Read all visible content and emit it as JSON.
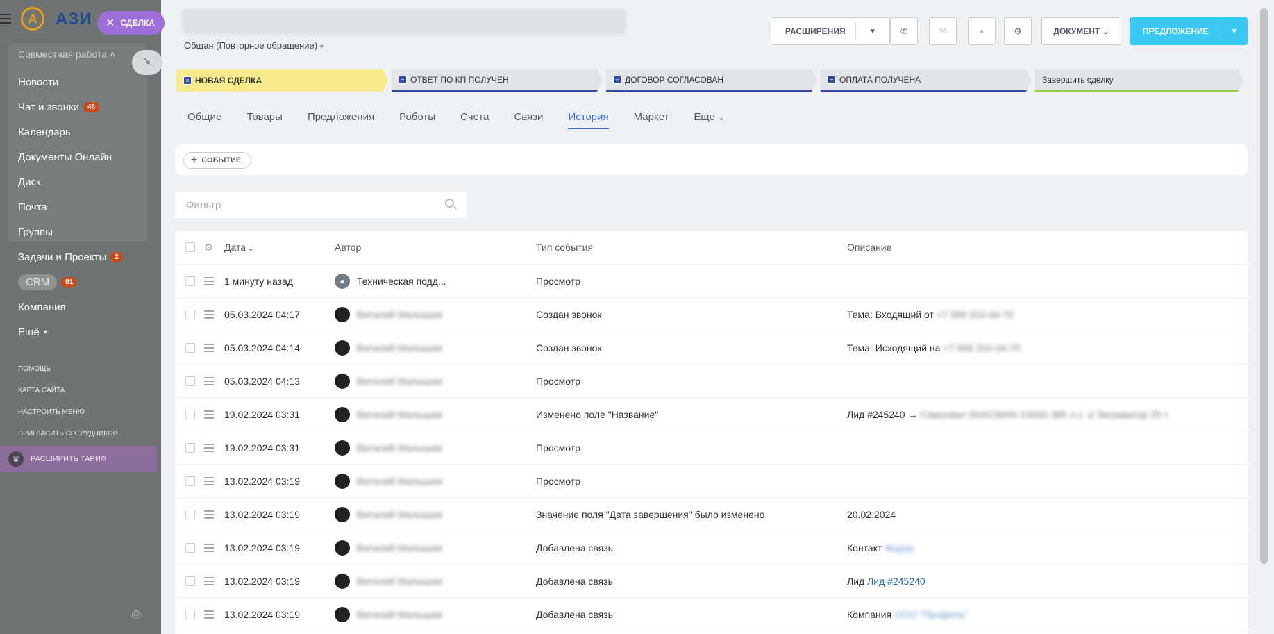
{
  "sidebar": {
    "logo": "A",
    "brand": "АЗИ",
    "deal_chip": "СДЕЛКА",
    "collab_title": "Совместная работа",
    "items": [
      {
        "label": "Новости"
      },
      {
        "label": "Чат и звонки",
        "badge": "46"
      },
      {
        "label": "Календарь"
      },
      {
        "label": "Документы Онлайн"
      },
      {
        "label": "Диск"
      },
      {
        "label": "Почта"
      },
      {
        "label": "Группы"
      },
      {
        "label": "Задачи и Проекты",
        "badge": "2"
      },
      {
        "label": "CRM",
        "badge": "81"
      },
      {
        "label": "Компания"
      },
      {
        "label": "Ещё"
      }
    ],
    "small_links": [
      "ПОМОЩЬ",
      "КАРТА САЙТА",
      "НАСТРОИТЬ МЕНЮ",
      "ПРИГЛАСИТЬ СОТРУДНИКОВ"
    ],
    "upgrade": "РАСШИРИТЬ ТАРИФ"
  },
  "header": {
    "subtitle": "Общая (Повторное обращение)",
    "extensions_label": "РАСШИРЕНИЯ",
    "document_label": "ДОКУМЕНТ",
    "offer_label": "ПРЕДЛОЖЕНИЕ"
  },
  "stages": [
    {
      "label": "НОВАЯ СДЕЛКА"
    },
    {
      "label": "ОТВЕТ ПО КП ПОЛУЧЕН"
    },
    {
      "label": "ДОГОВОР СОГЛАСОВАН"
    },
    {
      "label": "ОПЛАТА ПОЛУЧЕНА"
    },
    {
      "label": "Завершить сделку"
    }
  ],
  "tabs": [
    {
      "label": "Общие"
    },
    {
      "label": "Товары"
    },
    {
      "label": "Предложения"
    },
    {
      "label": "Роботы"
    },
    {
      "label": "Счета"
    },
    {
      "label": "Связи"
    },
    {
      "label": "История",
      "active": true
    },
    {
      "label": "Маркет"
    },
    {
      "label": "Еще"
    }
  ],
  "event_button": "СОБЫТИЕ",
  "filter": {
    "placeholder": "Фильтр"
  },
  "grid": {
    "columns": {
      "date": "Дата",
      "author": "Автор",
      "type": "Тип события",
      "description": "Описание"
    },
    "rows": [
      {
        "date": "1 минуту назад",
        "author": "Техническая подд...",
        "type": "Просмотр",
        "desc_prefix": "",
        "desc_value": ""
      },
      {
        "date": "05.03.2024 04:17",
        "author": "Виталий Малышев",
        "type": "Создан звонок",
        "desc_prefix": "Тема: Входящий от",
        "desc_value": "+7 999 310-34-70"
      },
      {
        "date": "05.03.2024 04:14",
        "author": "Виталий Малышев",
        "type": "Создан звонок",
        "desc_prefix": "Тема: Исходящий на",
        "desc_value": "+7 999 310-34-70"
      },
      {
        "date": "05.03.2024 04:13",
        "author": "Виталий Малышев",
        "type": "Просмотр",
        "desc_prefix": "",
        "desc_value": ""
      },
      {
        "date": "19.02.2024 03:31",
        "author": "Виталий Малышев",
        "type": "Изменено поле \"Название\"",
        "desc_prefix": "Лид #245240 →",
        "desc_value": "Самосвал SHACMAN X3000 385 л.с. и Экскаватор 25 т"
      },
      {
        "date": "19.02.2024 03:31",
        "author": "Виталий Малышев",
        "type": "Просмотр",
        "desc_prefix": "",
        "desc_value": ""
      },
      {
        "date": "13.02.2024 03:19",
        "author": "Виталий Малышев",
        "type": "Просмотр",
        "desc_prefix": "",
        "desc_value": ""
      },
      {
        "date": "13.02.2024 03:19",
        "author": "Виталий Малышев",
        "type": "Значение поля \"Дата завершения\" было изменено",
        "desc_prefix": "20.02.2024",
        "desc_value": ""
      },
      {
        "date": "13.02.2024 03:19",
        "author": "Виталий Малышев",
        "type": "Добавлена связь",
        "desc_prefix": "Контакт",
        "desc_value": "Федор"
      },
      {
        "date": "13.02.2024 03:19",
        "author": "Виталий Малышев",
        "type": "Добавлена связь",
        "desc_prefix": "Лид",
        "desc_value": "Лид #245240"
      },
      {
        "date": "13.02.2024 03:19",
        "author": "Виталий Малышев",
        "type": "Добавлена связь",
        "desc_prefix": "Компания",
        "desc_value": "ООО \"Профиль\""
      }
    ]
  },
  "colors": {
    "accent": "#3bc8f5",
    "active_tab": "#3d6ddb",
    "stage_active": "#f7ea8c",
    "sidebar": "#6f7373",
    "badge": "#c94a18"
  },
  "icons": [
    "burger-icon",
    "close-icon",
    "collapse-icon",
    "chevron-down-icon",
    "phone-icon",
    "mail-icon",
    "chat-icon",
    "gear-icon",
    "plus-icon",
    "search-icon",
    "menu-icon",
    "avatar-icon",
    "crown-icon",
    "printer-icon"
  ]
}
